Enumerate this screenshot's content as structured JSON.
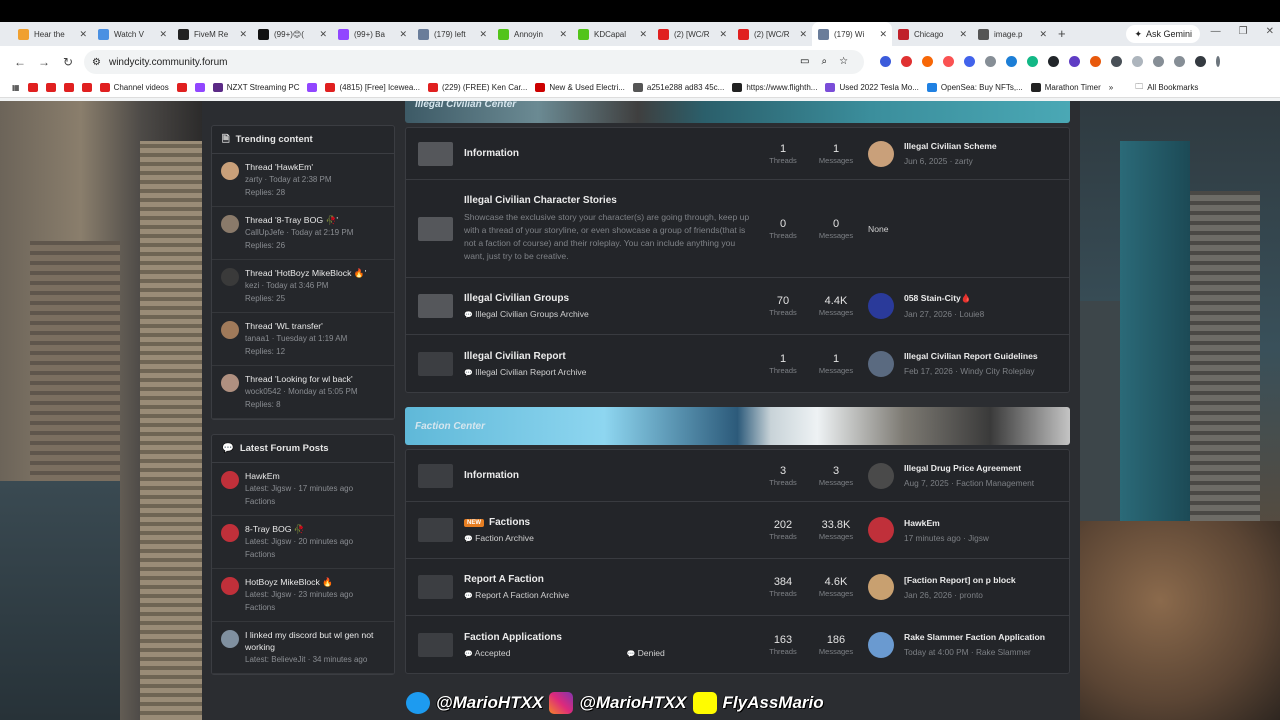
{
  "browser": {
    "tabs": [
      {
        "label": "Hear the",
        "color": "#f0a030"
      },
      {
        "label": "Watch V",
        "color": "#4a90e2"
      },
      {
        "label": "FiveM Re",
        "color": "#222222"
      },
      {
        "label": "(99+)😊(",
        "color": "#111111"
      },
      {
        "label": "(99+) Ba",
        "color": "#9146ff"
      },
      {
        "label": "(179) left",
        "color": "#6a7d9a"
      },
      {
        "label": "Annoyin",
        "color": "#53c41a"
      },
      {
        "label": "KDCapal",
        "color": "#53c41a"
      },
      {
        "label": "(2) [WC/R",
        "color": "#e02020"
      },
      {
        "label": "(2) [WC/R",
        "color": "#e02020"
      },
      {
        "label": "(179) Wi",
        "color": "#6a7d9a",
        "active": true
      },
      {
        "label": "Chicago",
        "color": "#c0202a"
      },
      {
        "label": "image.p",
        "color": "#555555"
      }
    ],
    "gemini": "Ask Gemini",
    "url": "windycity.community.forum",
    "bookmarks": [
      {
        "label": "",
        "color": "#e02020"
      },
      {
        "label": "",
        "color": "#e02020"
      },
      {
        "label": "",
        "color": "#e02020"
      },
      {
        "label": "",
        "color": "#e02020"
      },
      {
        "label": "Channel videos",
        "color": "#e02020"
      },
      {
        "label": "",
        "color": "#e02020"
      },
      {
        "label": "",
        "color": "#9146ff"
      },
      {
        "label": "NZXT Streaming PC",
        "color": "#5b2a86"
      },
      {
        "label": "",
        "color": "#9146ff"
      },
      {
        "label": "(4815) [Free] Icewea...",
        "color": "#e02020"
      },
      {
        "label": "(229) (FREE) Ken Car...",
        "color": "#e02020"
      },
      {
        "label": "New & Used Electri...",
        "color": "#cc0000"
      },
      {
        "label": "a251e288 ad83 45c...",
        "color": "#555555"
      },
      {
        "label": "https://www.flighth...",
        "color": "#222222"
      },
      {
        "label": "Used 2022 Tesla Mo...",
        "color": "#7a4dd8"
      },
      {
        "label": "OpenSea: Buy NFTs,...",
        "color": "#2081e2"
      },
      {
        "label": "Marathon Timer",
        "color": "#222222"
      }
    ],
    "all_bookmarks": "All Bookmarks"
  },
  "sidebar": {
    "trending": {
      "title": "Trending content",
      "items": [
        {
          "title": "Thread 'HawkEm'",
          "meta": "zarty · Today at 2:38 PM",
          "replies": "Replies: 28",
          "color": "#c9a07a"
        },
        {
          "title": "Thread '8-Tray BOG 🥀'",
          "meta": "CallUpJefe · Today at 2:19 PM",
          "replies": "Replies: 26",
          "color": "#8a7a6a"
        },
        {
          "title": "Thread 'HotBoyz MikeBlock 🔥'",
          "meta": "kezi · Today at 3:46 PM",
          "replies": "Replies: 25",
          "color": "#3a3a3a"
        },
        {
          "title": "Thread 'WL transfer'",
          "meta": "tanaa1 · Tuesday at 1:19 AM",
          "replies": "Replies: 12",
          "color": "#a07a5a"
        },
        {
          "title": "Thread 'Looking for wl back'",
          "meta": "wock0542 · Monday at 5:05 PM",
          "replies": "Replies: 8",
          "color": "#b09080"
        }
      ]
    },
    "latest": {
      "title": "Latest Forum Posts",
      "items": [
        {
          "title": "HawkEm",
          "meta": "Latest: Jigsw · 17 minutes ago",
          "forum": "Factions",
          "color": "#c0303a"
        },
        {
          "title": "8-Tray BOG 🥀",
          "meta": "Latest: Jigsw · 20 minutes ago",
          "forum": "Factions",
          "color": "#c0303a"
        },
        {
          "title": "HotBoyz MikeBlock 🔥",
          "meta": "Latest: Jigsw · 23 minutes ago",
          "forum": "Factions",
          "color": "#c0303a"
        },
        {
          "title": "I linked my discord but wl gen not working",
          "meta": "Latest: BelieveJit · 34 minutes ago",
          "forum": "",
          "color": "#8090a0"
        }
      ]
    }
  },
  "main": {
    "categories": [
      {
        "banner": "Illegal Civilian Center",
        "nodes": [
          {
            "title": "Information",
            "desc": "",
            "subs": [],
            "threads": "1",
            "messages": "1",
            "last_title": "Illegal Civilian Scheme",
            "last_meta": "Jun 6, 2025 · zarty",
            "avatar": "#c9a07a",
            "height": 52
          },
          {
            "title": "Illegal Civilian Character Stories",
            "desc": "Showcase the exclusive story your character(s) are going through, keep up with a thread of your storyline, or even showcase a group of friends(that is not a faction of course) and their roleplay. You can include anything you want, just try to be creative.",
            "subs": [],
            "threads": "0",
            "messages": "0",
            "last_title": "None",
            "last_meta": "",
            "avatar": "",
            "height": 98
          },
          {
            "title": "Illegal Civilian Groups",
            "desc": "",
            "subs": [
              "Illegal Civilian Groups Archive"
            ],
            "threads": "70",
            "messages": "4.4K",
            "last_title": "058 Stain-City🩸",
            "last_meta": "Jan 27, 2026 · Louie8",
            "avatar": "#2a3a9a",
            "height": 57
          },
          {
            "title": "Illegal Civilian Report",
            "desc": "",
            "subs": [
              "Illegal Civilian Report Archive"
            ],
            "threads": "1",
            "messages": "1",
            "last_title": "Illegal Civilian Report Guidelines",
            "last_meta": "Feb 17, 2026 · Windy City Roleplay",
            "avatar": "#5a6a80",
            "height": 57
          }
        ]
      },
      {
        "banner": "Faction Center",
        "nodes": [
          {
            "title": "Information",
            "desc": "",
            "subs": [],
            "threads": "3",
            "messages": "3",
            "last_title": "Illegal Drug Price Agreement",
            "last_meta": "Aug 7, 2025 · Faction Management",
            "avatar": "#4a4a4a",
            "height": 52
          },
          {
            "title": "Factions",
            "badge": "NEW",
            "desc": "",
            "subs": [
              "Faction Archive"
            ],
            "threads": "202",
            "messages": "33.8K",
            "last_title": "HawkEm",
            "last_meta": "17 minutes ago · Jigsw",
            "avatar": "#c0303a",
            "height": 57
          },
          {
            "title": "Report A Faction",
            "desc": "",
            "subs": [
              "Report A Faction Archive"
            ],
            "threads": "384",
            "messages": "4.6K",
            "last_title": "[Faction Report] on p block",
            "last_meta": "Jan 26, 2026 · pronto",
            "avatar": "#c8a070",
            "height": 57
          },
          {
            "title": "Faction Applications",
            "desc": "",
            "subs": [
              "Accepted",
              "Denied"
            ],
            "threads": "163",
            "messages": "186",
            "last_title": "Rake Slammer Faction Application",
            "last_meta": "Today at 4:00 PM · Rake Slammer",
            "avatar": "#6a9ad0",
            "height": 57
          }
        ]
      }
    ],
    "labels": {
      "threads": "Threads",
      "messages": "Messages"
    }
  },
  "social": {
    "twitter": "@MarioHTXX",
    "instagram": "@MarioHTXX",
    "snapchat": "FlyAssMario"
  }
}
